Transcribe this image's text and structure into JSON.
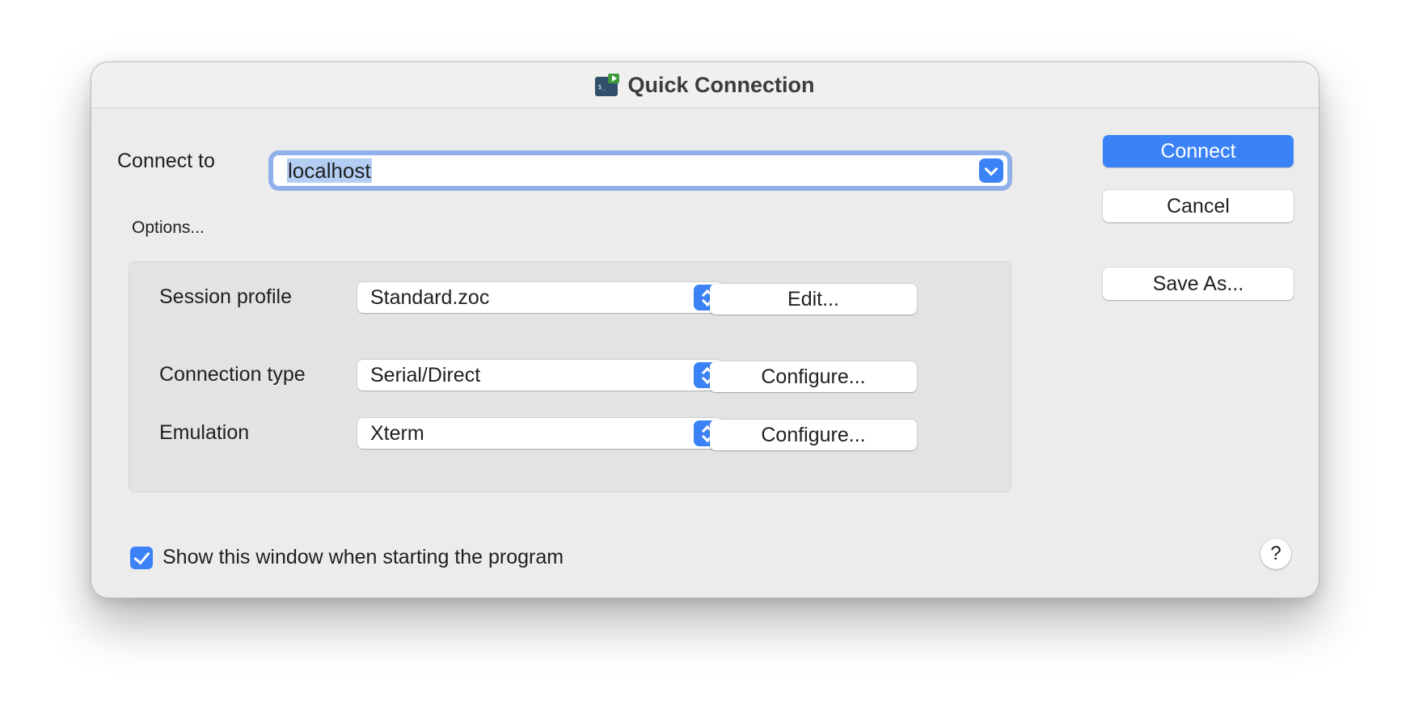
{
  "window": {
    "title": "Quick Connection",
    "app_icon": "terminal-play-icon"
  },
  "connect_to": {
    "label": "Connect to",
    "value": "localhost"
  },
  "options": {
    "label": "Options...",
    "rows": [
      {
        "label": "Session profile",
        "value": "Standard.zoc",
        "button": "Edit..."
      },
      {
        "label": "Connection type",
        "value": "Serial/Direct",
        "button": "Configure..."
      },
      {
        "label": "Emulation",
        "value": "Xterm",
        "button": "Configure..."
      }
    ]
  },
  "buttons": {
    "connect": "Connect",
    "cancel": "Cancel",
    "save_as": "Save As..."
  },
  "footer": {
    "show_on_start_label": "Show this window when starting the program",
    "show_on_start_checked": true,
    "help": "?"
  },
  "colors": {
    "accent": "#3b82f7",
    "selection": "#b3cdf3",
    "focus_ring": "#8fb0ea"
  }
}
